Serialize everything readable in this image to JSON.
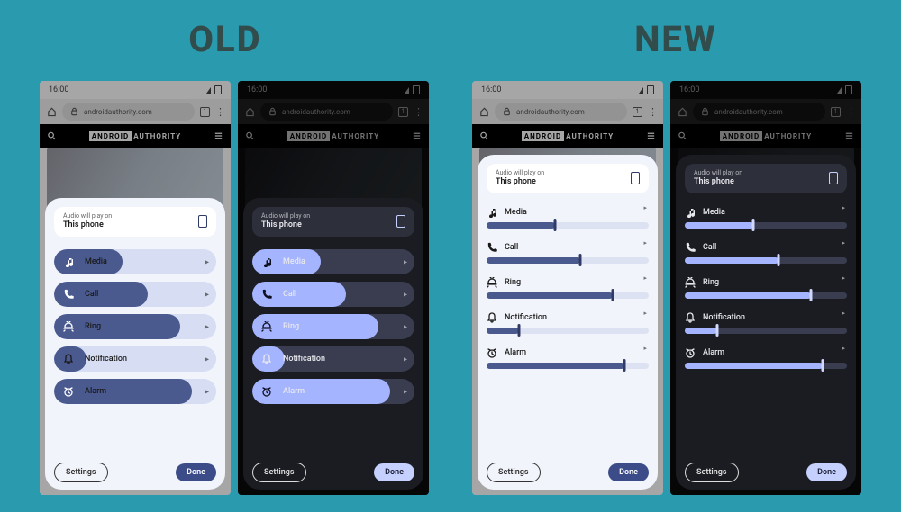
{
  "headings": {
    "old": "OLD",
    "new": "NEW"
  },
  "status": {
    "time": "16:00"
  },
  "browser": {
    "url": "androidauthority.com",
    "tabcount": "1"
  },
  "site": {
    "brand_a": "ANDROID",
    "brand_b": "AUTHORITY"
  },
  "panel": {
    "play_label": "Audio will play on",
    "play_device": "This phone",
    "settings": "Settings",
    "done": "Done"
  },
  "sliders": {
    "media": {
      "label": "Media",
      "icon": "music-note-icon",
      "pct": 42
    },
    "call": {
      "label": "Call",
      "icon": "phone-icon",
      "pct": 58
    },
    "ring": {
      "label": "Ring",
      "icon": "ring-icon",
      "pct": 78
    },
    "notification": {
      "label": "Notification",
      "icon": "bell-icon",
      "pct": 20
    },
    "alarm": {
      "label": "Alarm",
      "icon": "alarm-icon",
      "pct": 85
    }
  }
}
